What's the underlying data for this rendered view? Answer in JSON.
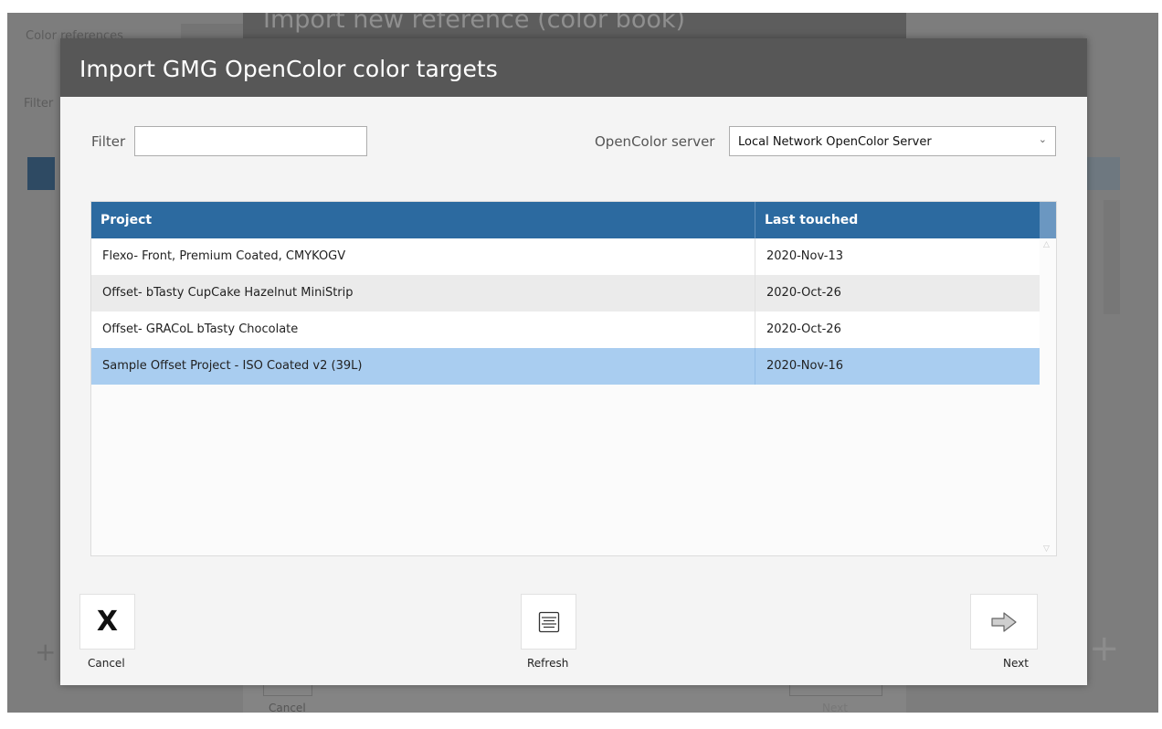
{
  "background": {
    "dialog_title": "Import new reference (color book)",
    "tab_label": "Color references",
    "filter_label": "Filter",
    "cancel_label": "Cancel",
    "next_label": "Next"
  },
  "dialog": {
    "title": "Import GMG OpenColor color targets",
    "filter": {
      "label": "Filter",
      "value": "",
      "placeholder": ""
    },
    "server": {
      "label": "OpenColor server",
      "selected": "Local Network OpenColor Server"
    },
    "table": {
      "columns": [
        "Project",
        "Last touched"
      ],
      "rows": [
        {
          "project": "Flexo- Front, Premium Coated, CMYKOGV",
          "last_touched": "2020-Nov-13"
        },
        {
          "project": "Offset- bTasty CupCake Hazelnut MiniStrip",
          "last_touched": "2020-Oct-26"
        },
        {
          "project": "Offset- GRACoL bTasty Chocolate",
          "last_touched": "2020-Oct-26"
        },
        {
          "project": "Sample Offset Project - ISO Coated v2 (39L)",
          "last_touched": "2020-Nov-16"
        }
      ],
      "selected_index": 3
    },
    "buttons": {
      "cancel": "Cancel",
      "refresh": "Refresh",
      "next": "Next"
    }
  },
  "colors": {
    "header_bg": "#575757",
    "table_header": "#2c6aa0",
    "selected_row": "#a9cdf0"
  }
}
